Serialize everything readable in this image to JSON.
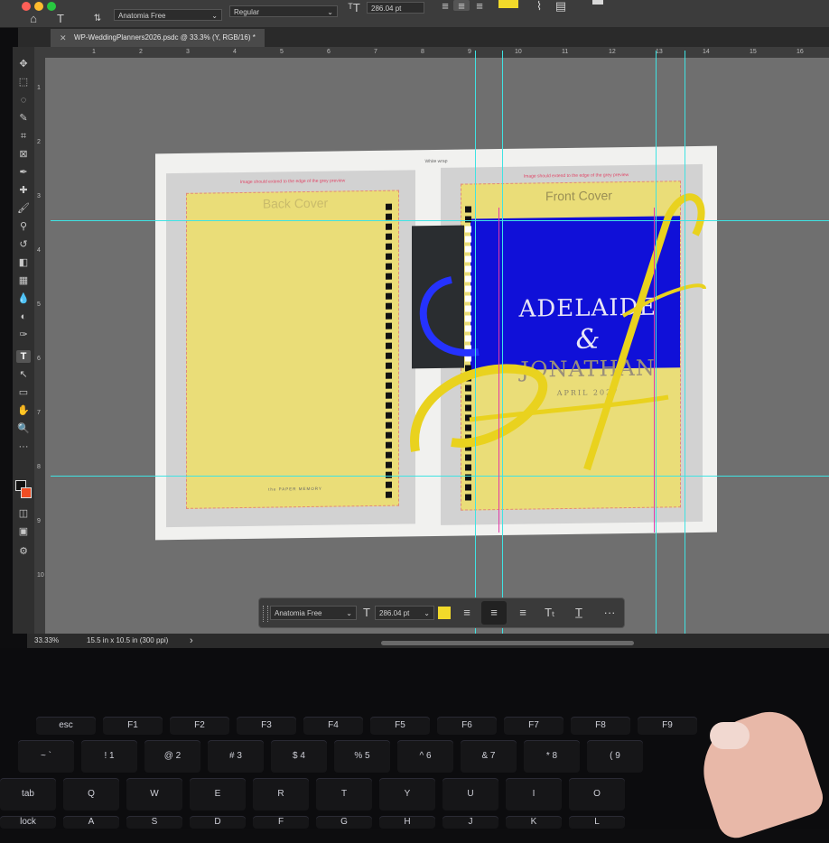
{
  "window": {
    "traffic_colors": [
      "#ff5f57",
      "#febc2e",
      "#28c840"
    ]
  },
  "options_bar": {
    "font_family": "Anatomia Free",
    "font_style": "Regular",
    "font_size": "286.04 pt",
    "color_swatch": "#f2da2a"
  },
  "document_tab": {
    "title": "WP-WeddingPlanners2026.psdc @ 33.3% (Y, RGB/16) *"
  },
  "ruler": {
    "h_ticks": [
      "1",
      "2",
      "3",
      "4",
      "5",
      "6",
      "7",
      "8",
      "9",
      "10",
      "11",
      "12",
      "13",
      "14",
      "15",
      "16"
    ],
    "v_ticks": [
      "1",
      "2",
      "3",
      "4",
      "5",
      "6",
      "7",
      "8",
      "9",
      "10"
    ]
  },
  "document": {
    "wrap_label": "White wrap",
    "bleed_note": "Image should extend to the edge of the grey preview",
    "back_cover_title": "Back Cover",
    "front_cover_title": "Front Cover",
    "brand": "the PAPER MEMORY",
    "name1": "ADELAIDE",
    "ampersand": "&",
    "name2": "JONATHAN",
    "date": "APRIL 2027"
  },
  "context_bar": {
    "font": "Anatomia Free",
    "size": "286.04 pt",
    "more": "···",
    "swatch": "#f2da2a"
  },
  "status_bar": {
    "zoom": "33.33%",
    "doc_size": "15.5 in x 10.5 in (300 ppi)",
    "arrow": "›"
  },
  "keyboard": {
    "fn_row": [
      "esc",
      "F1",
      "F2",
      "F3",
      "F4",
      "F5",
      "F6",
      "F7",
      "F8",
      "F9"
    ],
    "num_row": [
      "~",
      "!",
      "@",
      "#",
      "$",
      "%",
      "^",
      "&",
      "*",
      "("
    ],
    "num_row_low": [
      "`",
      "1",
      "2",
      "3",
      "4",
      "5",
      "6",
      "7",
      "8",
      "9"
    ],
    "q_row": [
      "tab",
      "Q",
      "W",
      "E",
      "R",
      "T",
      "Y",
      "U",
      "I",
      "O"
    ],
    "a_row": [
      "lock",
      "A",
      "S",
      "D",
      "F",
      "G",
      "H",
      "J",
      "K",
      "L"
    ]
  },
  "colors": {
    "guide": "#3fe3e3",
    "cover_yellow": "#eadd78",
    "photo_blue": "#1010d8",
    "canvas": "#6f6f6f"
  }
}
